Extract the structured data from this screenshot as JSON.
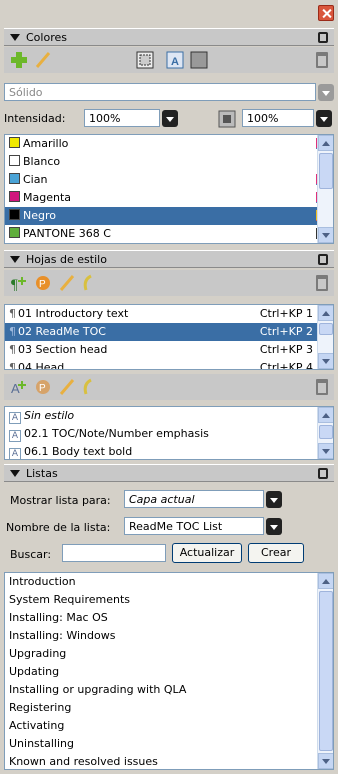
{
  "colores": {
    "title": "Colores",
    "fill_value": "Sólido",
    "tint_label": "Intensidad:",
    "tint_value": "100%",
    "tint2_value": "100%",
    "swatches": [
      {
        "name": "Amarillo",
        "color": "#f0e800"
      },
      {
        "name": "Blanco",
        "color": "#ffffff"
      },
      {
        "name": "Cian",
        "color": "#4aa3d6"
      },
      {
        "name": "Magenta",
        "color": "#d0157d"
      },
      {
        "name": "Negro",
        "color": "#000000"
      },
      {
        "name": "PANTONE 368 C",
        "color": "#5fae3c"
      }
    ],
    "selected_index": 4
  },
  "hojas": {
    "title": "Hojas de estilo",
    "paragraph_styles": [
      {
        "name": "01 Introductory text",
        "shortcut": "Ctrl+KP 1"
      },
      {
        "name": "02 ReadMe TOC",
        "shortcut": "Ctrl+KP 2"
      },
      {
        "name": "03 Section head",
        "shortcut": "Ctrl+KP 3"
      },
      {
        "name": "04 Head",
        "shortcut": "Ctrl+KP 4"
      }
    ],
    "selected_index": 1,
    "char_styles": [
      "Sin estilo",
      "02.1 TOC/Note/Number emphasis",
      "06.1 Body text bold"
    ]
  },
  "listas": {
    "title": "Listas",
    "show_list_label": "Mostrar lista para:",
    "show_list_value": "Capa actual",
    "list_name_label": "Nombre de la lista:",
    "list_name_value": "ReadMe TOC List",
    "search_label": "Buscar:",
    "update_button": "Actualizar",
    "create_button": "Crear",
    "items": [
      "Introduction",
      "System Requirements",
      "Installing: Mac OS",
      "Installing: Windows",
      "Upgrading",
      "Updating",
      "Installing or upgrading with QLA",
      "Registering",
      "Activating",
      "Uninstalling",
      "Known and resolved issues"
    ]
  }
}
